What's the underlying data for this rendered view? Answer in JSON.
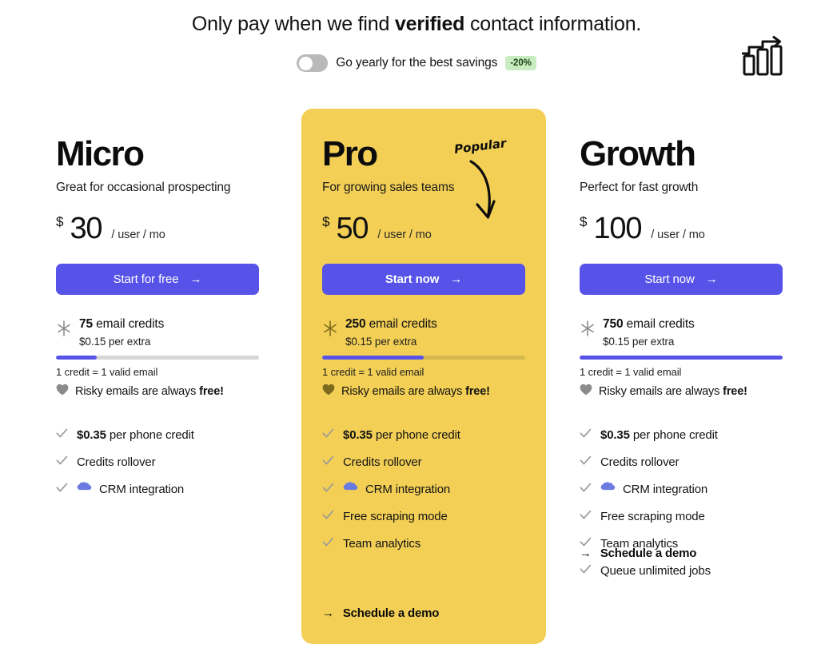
{
  "header": {
    "headline_pre": "Only pay when we find ",
    "headline_bold": "verified",
    "headline_post": " contact information.",
    "billing_toggle_label": "Go yearly for the best savings",
    "discount_badge": "-20%",
    "toggle_state": "off",
    "logo_icon": "bar-chart-growth-icon"
  },
  "colors": {
    "accent_purple": "#5753e8",
    "pro_card_yellow": "#f3cf55",
    "badge_green": "#c8ecc0",
    "track_gray": "#d7d7d7",
    "cloud_blue": "#6a7ae0"
  },
  "plans": [
    {
      "id": "micro",
      "name": "Micro",
      "tagline": "Great for occasional prospecting",
      "currency": "$",
      "price": "30",
      "unit": "/ user / mo",
      "cta_label": "Start for free",
      "cta_arrow": "→",
      "credits_amount": "75",
      "credits_word": "email credits",
      "credits_extra": "$0.15 per extra",
      "bar_fill_percent": 20,
      "credit_note": "1 credit = 1 valid email",
      "risky_text": "Risky emails are always ",
      "risky_bold": "free!",
      "features": [
        {
          "bold": "$0.35",
          "text": " per phone credit",
          "icon": "none"
        },
        {
          "bold": "",
          "text": "Credits rollover",
          "icon": "none"
        },
        {
          "bold": "",
          "text": "CRM integration",
          "icon": "salesforce-cloud-icon"
        }
      ],
      "demo_link": null
    },
    {
      "id": "pro",
      "name": "Pro",
      "tagline": "For growing sales teams",
      "currency": "$",
      "price": "50",
      "unit": "/ user / mo",
      "cta_label": "Start now",
      "cta_arrow": "→",
      "credits_amount": "250",
      "credits_word": "email credits",
      "credits_extra": "$0.15 per extra",
      "bar_fill_percent": 50,
      "credit_note": "1 credit = 1 valid email",
      "risky_text": "Risky emails are always ",
      "risky_bold": "free!",
      "features": [
        {
          "bold": "$0.35",
          "text": " per phone credit",
          "icon": "none"
        },
        {
          "bold": "",
          "text": "Credits rollover",
          "icon": "none"
        },
        {
          "bold": "",
          "text": "CRM integration",
          "icon": "salesforce-cloud-icon"
        },
        {
          "bold": "",
          "text": "Free scraping mode",
          "icon": "none"
        },
        {
          "bold": "",
          "text": "Team analytics",
          "icon": "none"
        }
      ],
      "demo_link": "Schedule a demo",
      "demo_arrow": "→",
      "badge_label": "Popular"
    },
    {
      "id": "growth",
      "name": "Growth",
      "tagline": "Perfect for fast growth",
      "currency": "$",
      "price": "100",
      "unit": "/ user / mo",
      "cta_label": "Start now",
      "cta_arrow": "→",
      "credits_amount": "750",
      "credits_word": "email credits",
      "credits_extra": "$0.15 per extra",
      "bar_fill_percent": 100,
      "credit_note": "1 credit = 1 valid email",
      "risky_text": "Risky emails are always ",
      "risky_bold": "free!",
      "features": [
        {
          "bold": "$0.35",
          "text": " per phone credit",
          "icon": "none"
        },
        {
          "bold": "",
          "text": "Credits rollover",
          "icon": "none"
        },
        {
          "bold": "",
          "text": "CRM integration",
          "icon": "salesforce-cloud-icon"
        },
        {
          "bold": "",
          "text": "Free scraping mode",
          "icon": "none"
        },
        {
          "bold": "",
          "text": "Team analytics",
          "icon": "none"
        },
        {
          "bold": "",
          "text": "Queue unlimited jobs",
          "icon": "none"
        }
      ],
      "demo_link": "Schedule a demo",
      "demo_arrow": "→"
    }
  ]
}
